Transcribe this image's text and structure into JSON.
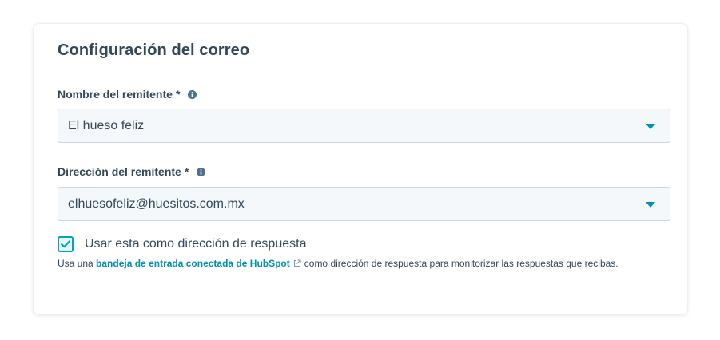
{
  "card": {
    "title": "Configuración del correo"
  },
  "sender_name": {
    "label": "Nombre del remitente",
    "required_mark": "*",
    "value": "El hueso feliz"
  },
  "sender_address": {
    "label": "Dirección del remitente",
    "required_mark": "*",
    "value": "elhuesofeliz@huesitos.com.mx"
  },
  "reply_to": {
    "checked": true,
    "label": "Usar esta como dirección de respuesta",
    "help_prefix": "Usa una",
    "help_link": "bandeja de entrada conectada de HubSpot",
    "help_suffix": "como dirección de respuesta para monitorizar las respuestas que recibas."
  },
  "icons": {
    "info": "info-icon",
    "caret": "caret-down-icon",
    "check": "checkmark-icon",
    "external": "external-link-icon"
  },
  "colors": {
    "text": "#33475b",
    "accent": "#00a4bd",
    "link": "#0091ae",
    "input_bg": "#f5f8fa",
    "input_border": "#cbd6e2"
  }
}
